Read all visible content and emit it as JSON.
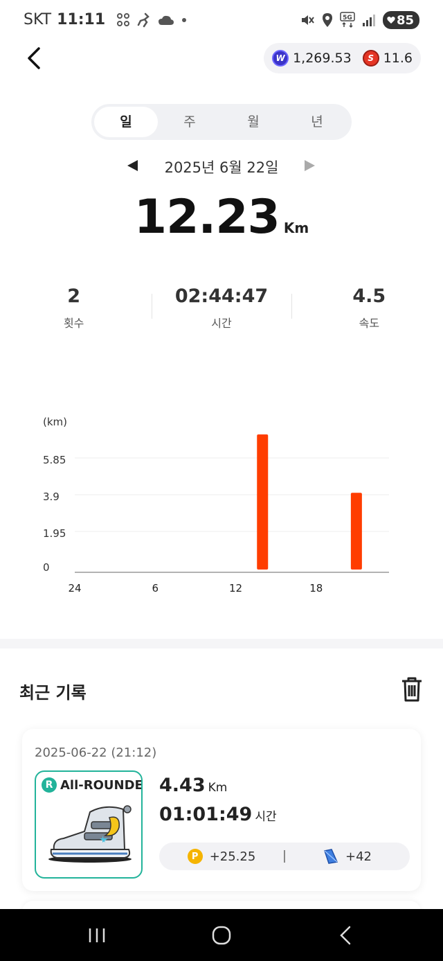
{
  "status_bar": {
    "carrier": "SKT",
    "time": "11:11",
    "battery": "85",
    "left_icons": [
      "grid-app-icon",
      "running-icon",
      "cloud-icon",
      "dot-icon"
    ],
    "right_icons": [
      "mute-vibrate-icon",
      "location-icon",
      "5g-icon",
      "signal-icon"
    ]
  },
  "header": {
    "balances": [
      {
        "icon": "w-coin-icon",
        "value": "1,269.53",
        "color": "#3b34c8"
      },
      {
        "icon": "s-coin-icon",
        "value": "11.6",
        "color": "#e53525"
      }
    ]
  },
  "period_tabs": [
    {
      "label": "일",
      "active": true
    },
    {
      "label": "주",
      "active": false
    },
    {
      "label": "월",
      "active": false
    },
    {
      "label": "년",
      "active": false
    }
  ],
  "date_label": "2025년 6월 22일",
  "distance": {
    "value": "12.23",
    "unit": "Km"
  },
  "stats": [
    {
      "value": "2",
      "label": "횟수"
    },
    {
      "value": "02:44:47",
      "label": "시간"
    },
    {
      "value": "4.5",
      "label": "속도"
    }
  ],
  "chart_data": {
    "type": "bar",
    "ylabel": "(km)",
    "y_ticks": [
      "0",
      "1.95",
      "3.9",
      "5.85"
    ],
    "x_ticks": [
      "24",
      "6",
      "12",
      "18"
    ],
    "ylim": [
      0,
      7.8
    ],
    "xlim": [
      0,
      24
    ],
    "bar_color": "#ff3d00",
    "bars": [
      {
        "hour": 14,
        "value": 7.1
      },
      {
        "hour": 21,
        "value": 4.0
      }
    ]
  },
  "recent": {
    "title": "최근 기록",
    "records": [
      {
        "datetime": "2025-06-22 (21:12)",
        "shoe_grade": "R",
        "shoe_label": "All-ROUNDER",
        "distance": "4.43",
        "distance_unit": "Km",
        "duration": "01:01:49",
        "duration_unit": "시간",
        "points": "+25.25",
        "gems": "+42"
      }
    ]
  },
  "colors": {
    "accent": "#ff3d00",
    "teal": "#22b39a"
  }
}
